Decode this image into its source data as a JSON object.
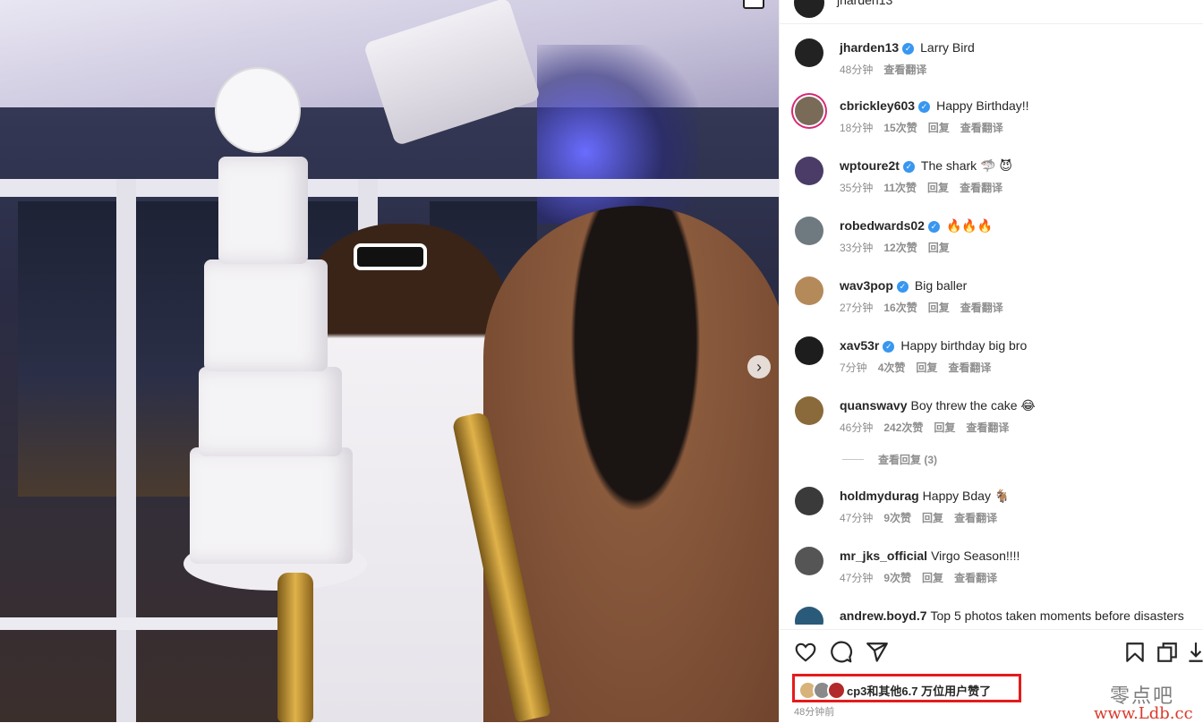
{
  "post": {
    "author": "jharden13"
  },
  "comments": [
    {
      "user": "jharden13",
      "verified": true,
      "text": "Larry Bird",
      "time": "48分钟",
      "likes": "",
      "reply": "",
      "translate": "查看翻译",
      "avatar_color": "#222222"
    },
    {
      "user": "cbrickley603",
      "verified": true,
      "text": "Happy Birthday!!",
      "time": "18分钟",
      "likes": "15次赞",
      "reply": "回复",
      "translate": "查看翻译",
      "avatar_color": "#7a6a58"
    },
    {
      "user": "wptoure2t",
      "verified": true,
      "text": "The shark 🦈 😈",
      "time": "35分钟",
      "likes": "11次赞",
      "reply": "回复",
      "translate": "查看翻译",
      "avatar_color": "#4a3c66"
    },
    {
      "user": "robedwards02",
      "verified": true,
      "text": "🔥🔥🔥",
      "time": "33分钟",
      "likes": "12次赞",
      "reply": "回复",
      "translate": "",
      "avatar_color": "#6f7a80"
    },
    {
      "user": "wav3pop",
      "verified": true,
      "text": "Big baller",
      "time": "27分钟",
      "likes": "16次赞",
      "reply": "回复",
      "translate": "查看翻译",
      "avatar_color": "#b58a5a"
    },
    {
      "user": "xav53r",
      "verified": true,
      "text": "Happy birthday big bro",
      "time": "7分钟",
      "likes": "4次赞",
      "reply": "回复",
      "translate": "查看翻译",
      "avatar_color": "#1d1d1d"
    },
    {
      "user": "quanswavy",
      "verified": false,
      "text": "Boy threw the cake 😂",
      "time": "46分钟",
      "likes": "242次赞",
      "reply": "回复",
      "translate": "查看翻译",
      "avatar_color": "#8a6a3a"
    },
    {
      "user": "holdmydurag",
      "verified": false,
      "text": "Happy Bday 🐐",
      "time": "47分钟",
      "likes": "9次赞",
      "reply": "回复",
      "translate": "查看翻译",
      "avatar_color": "#3a3a3a"
    },
    {
      "user": "mr_jks_official",
      "verified": false,
      "text": "Virgo Season!!!!",
      "time": "47分钟",
      "likes": "9次赞",
      "reply": "回复",
      "translate": "查看翻译",
      "avatar_color": "#555555"
    },
    {
      "user": "andrew.boyd.7",
      "verified": false,
      "text": "Top 5 photos taken moments before disasters",
      "time": "",
      "likes": "",
      "reply": "",
      "translate": "",
      "avatar_color": "#2a5a7a"
    }
  ],
  "view_replies": "查看回复 (3)",
  "likes_summary": "cp3和其他6.7 万位用户赞了",
  "post_time": "48分钟前",
  "watermark": {
    "cn": "零点吧",
    "url": "www.Ldb.cc"
  },
  "colors": {
    "verified": "#3897f0",
    "highlight_border": "#e51b1b",
    "meta_text": "#8e8e8e"
  }
}
